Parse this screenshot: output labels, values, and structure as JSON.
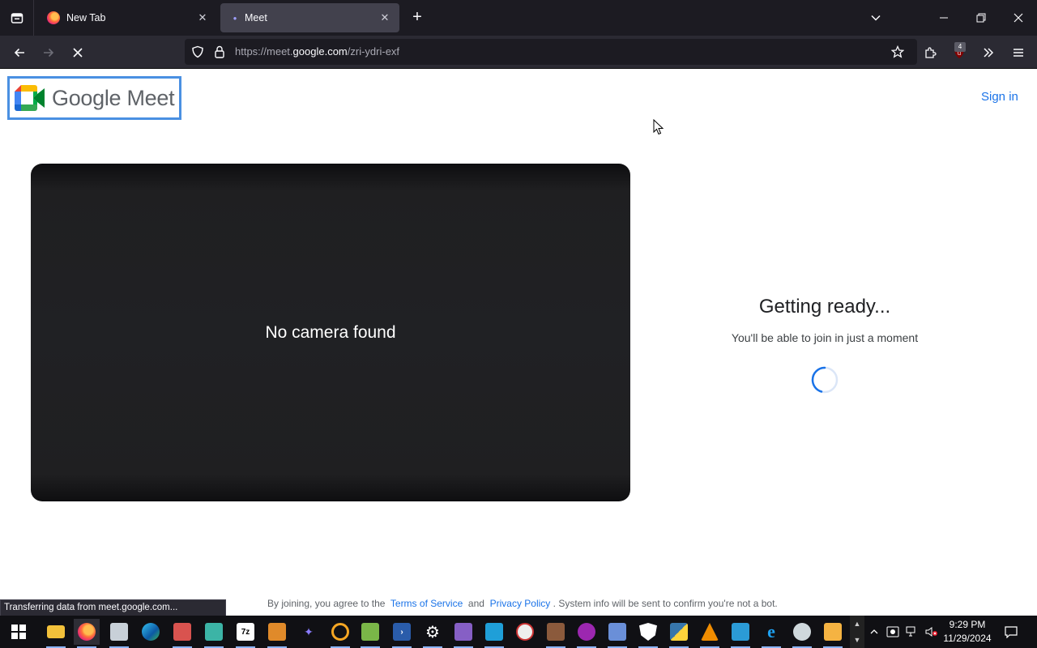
{
  "browser": {
    "tabs": [
      {
        "title": "New Tab",
        "active": false
      },
      {
        "title": "Meet",
        "active": true
      }
    ],
    "url": {
      "prefix": "https://meet.",
      "host": "google.com",
      "path": "/zri-ydri-exf"
    },
    "ublock_count": "4",
    "status_text": "Transferring data from meet.google.com..."
  },
  "meet": {
    "logo_text": "Google Meet",
    "sign_in": "Sign in",
    "camera_message": "No camera found",
    "ready_title": "Getting ready...",
    "ready_subtitle": "You'll be able to join in just a moment",
    "legal": {
      "pre": "By joining, you agree to the",
      "terms": "Terms of Service",
      "and": "and",
      "privacy": "Privacy Policy",
      "post": ". System info will be sent to confirm you're not a bot."
    }
  },
  "taskbar": {
    "time": "9:29 PM",
    "date": "11/29/2024",
    "apps": [
      "start",
      "file-explorer",
      "firefox",
      "app3",
      "edge",
      "app5",
      "app6",
      "7zip",
      "app8",
      "app9",
      "search-app",
      "notepad-plus",
      "powershell",
      "settings",
      "visual-studio",
      "app15",
      "app16",
      "app17",
      "app18",
      "app19",
      "security",
      "python",
      "vlc",
      "app23",
      "ie",
      "app25",
      "app26"
    ]
  },
  "colors": {
    "accent": "#1a73e8",
    "video_bg": "#202124",
    "browser_dark": "#1c1b22"
  }
}
